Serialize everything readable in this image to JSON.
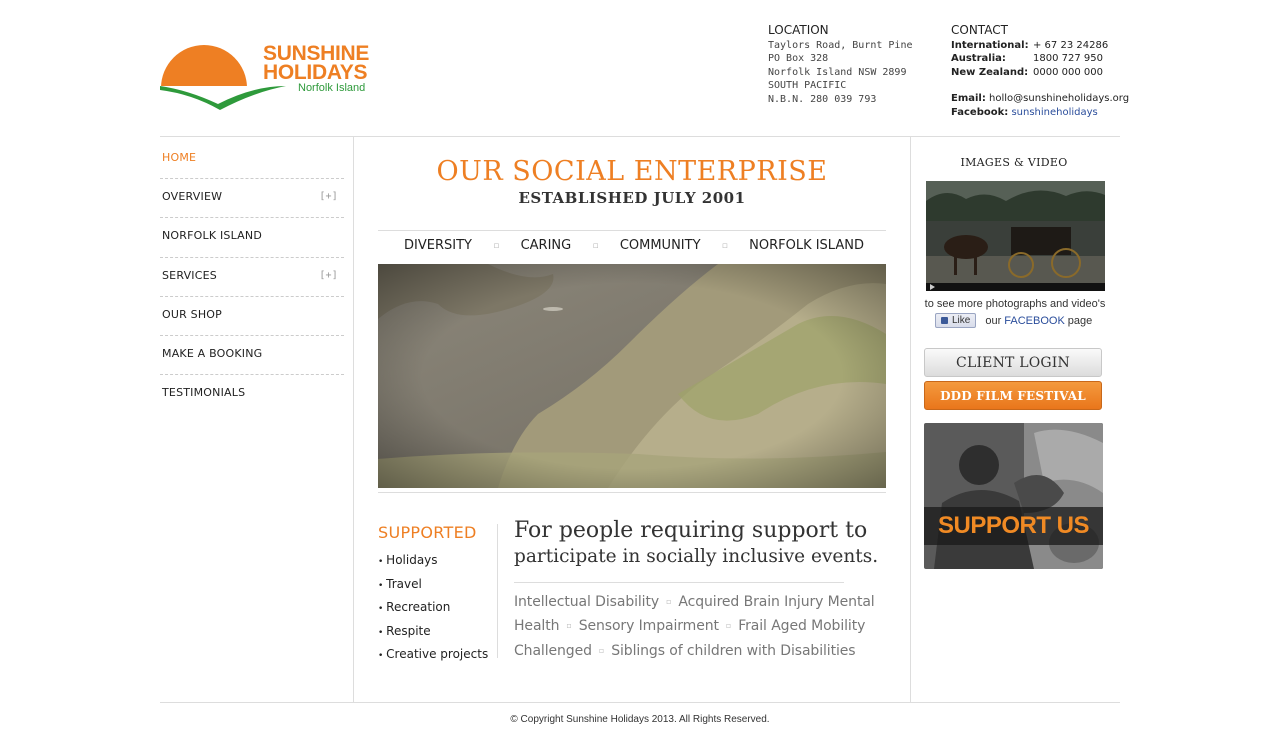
{
  "brand": {
    "name_line1": "SUNSHINE",
    "name_line2": "HOLIDAYS",
    "tagline": "Norfolk Island",
    "colors": {
      "orange": "#ee7f23",
      "green": "#2e9a3b"
    }
  },
  "location": {
    "heading": "LOCATION",
    "lines": [
      "Taylors Road, Burnt Pine",
      "PO Box 328",
      "Norfolk Island NSW 2899",
      "SOUTH PACIFIC",
      "N.B.N. 280 039 793"
    ]
  },
  "contact": {
    "heading": "CONTACT",
    "phones": [
      {
        "label": "International:",
        "value": "+ 67 23 24286"
      },
      {
        "label": "Australia:",
        "value": "1800 727 950"
      },
      {
        "label": "New Zealand:",
        "value": "0000 000 000"
      }
    ],
    "email_label": "Email:",
    "email": "hollo@sunshineholidays.org",
    "facebook_label": "Facebook:",
    "facebook": "sunshineholidays"
  },
  "nav": {
    "items": [
      {
        "label": "HOME",
        "expand": ""
      },
      {
        "label": "OVERVIEW",
        "expand": "[+]"
      },
      {
        "label": "NORFOLK ISLAND",
        "expand": ""
      },
      {
        "label": "SERVICES",
        "expand": "[+]"
      },
      {
        "label": "OUR SHOP",
        "expand": ""
      },
      {
        "label": "MAKE A BOOKING",
        "expand": ""
      },
      {
        "label": "TESTIMONIALS",
        "expand": ""
      }
    ]
  },
  "main": {
    "title": "OUR SOCIAL ENTERPRISE",
    "subtitle": "ESTABLISHED JULY 2001",
    "tags": [
      "DIVERSITY",
      "CARING",
      "COMMUNITY",
      "NORFOLK ISLAND"
    ],
    "hero_icon": "coastal-cliff-photo",
    "supported_title": "SUPPORTED",
    "supported_items": [
      "Holidays",
      "Travel",
      "Recreation",
      "Respite",
      "Creative projects"
    ],
    "big_line1": "For people requiring support to",
    "big_line2": "participate in socially inclusive events.",
    "categories": [
      "Intellectual Disability",
      "Acquired Brain Injury Mental Health",
      "Sensory Impairment",
      "Frail Aged Mobility Challenged",
      "Siblings of children with Disabilities"
    ]
  },
  "sidebar_right": {
    "images_title": "IMAGES & VIDEO",
    "video_icon": "horse-carriage-video",
    "fb_text": "to see more photographs and video's",
    "like_label": "Like",
    "our_text": "our",
    "facebook_link": "FACEBOOK",
    "page_text": "page",
    "login_label": "CLIENT LOGIN",
    "ddd_label": "DDD FILM FESTIVAL",
    "support_label": "SUPPORT US"
  },
  "footer": {
    "copyright": "© Copyright Sunshine Holidays 2013. All Rights Reserved."
  }
}
